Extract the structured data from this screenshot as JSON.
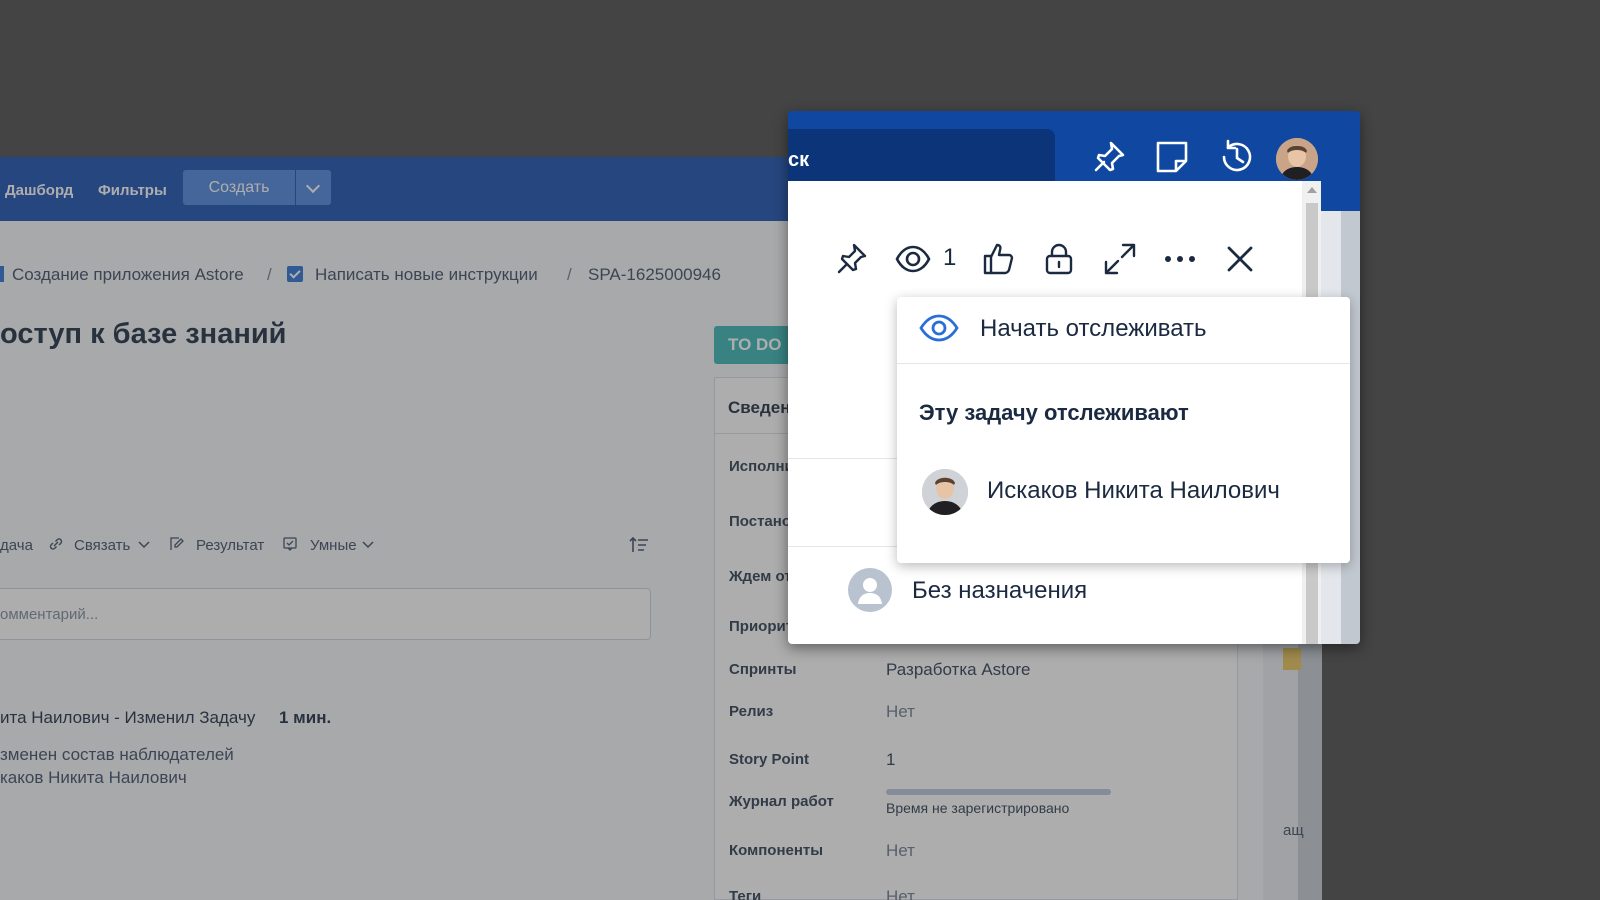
{
  "background": {
    "nav": {
      "dashboard": "Дашборд",
      "filters": "Фильтры",
      "create": "Создать"
    },
    "breadcrumb": {
      "project": "Создание приложения Astore",
      "sep1": "/",
      "parent": "Написать новые инструкции",
      "sep2": "/",
      "key": "SPA-1625000946"
    },
    "title": "оступ к базе знаний",
    "status": "TO DO",
    "details": {
      "header": "Сведен",
      "fields": [
        {
          "label": "Исполни",
          "value": ""
        },
        {
          "label": "Постано",
          "value": ""
        },
        {
          "label": "Ждем от",
          "value": ""
        },
        {
          "label": "Приорит",
          "value": ""
        },
        {
          "label": "Спринты",
          "value": "Разработка Astore"
        },
        {
          "label": "Релиз",
          "value": "Нет"
        },
        {
          "label": "Story Point",
          "value": "1"
        },
        {
          "label": "Журнал работ",
          "value": "Время не зарегистрировано"
        },
        {
          "label": "Компоненты",
          "value": "Нет"
        },
        {
          "label": "Теги",
          "value": "Нет"
        }
      ],
      "worklog_progress": 0
    },
    "toolbar": {
      "task": "дача",
      "link": "Связать",
      "result": "Результат",
      "smart": "Умные"
    },
    "comment_placeholder": "омментарий...",
    "activity": {
      "line1": "ита Наилович - Изменил Задачу",
      "time": "1 мин.",
      "line2": "зменен состав наблюдателей",
      "line3": "каков Никита Наилович"
    },
    "right_text": "ащ"
  },
  "popup": {
    "search_text": "ск",
    "watch_count": "1",
    "unassigned": "Без назначения",
    "dropdown": {
      "start_watching": "Начать отслеживать",
      "heading": "Эту задачу отслеживают",
      "watchers": [
        "Искаков Никита Наилович"
      ]
    }
  },
  "colors": {
    "nav": "#184fb0",
    "popup_header": "#0f47a1",
    "status": "#37b6b6",
    "accent": "#2a6fd6",
    "text": "#1b2a41"
  }
}
